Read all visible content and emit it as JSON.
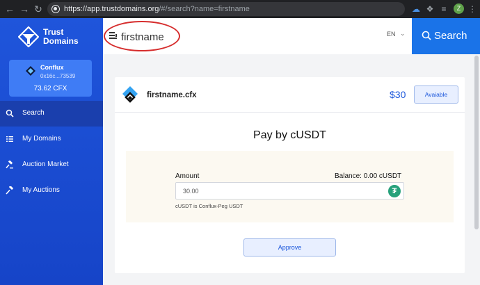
{
  "browser": {
    "url_host": "https://app.trustdomains.org",
    "url_rest": "/#/search?name=firstname",
    "profile_initial": "Z"
  },
  "brand": {
    "line1": "Trust",
    "line2": "Domains"
  },
  "wallet": {
    "name": "Conflux",
    "address": "0x16c...73539",
    "balance": "73.62 CFX"
  },
  "sidebar": {
    "items": [
      {
        "label": "Search",
        "icon": "search-icon",
        "active": true
      },
      {
        "label": "My Domains",
        "icon": "list-icon",
        "active": false
      },
      {
        "label": "Auction Market",
        "icon": "gavel-icon",
        "active": false
      },
      {
        "label": "My Auctions",
        "icon": "hammer-icon",
        "active": false
      }
    ]
  },
  "header": {
    "search_value": "firstname",
    "language": "EN",
    "search_button": "Search"
  },
  "domain": {
    "name": "firstname.cfx",
    "price": "$30",
    "status_button": "Avaiable"
  },
  "payment": {
    "title": "Pay by cUSDT",
    "amount_label": "Amount",
    "balance_label": "Balance: 0.00 cUSDT",
    "amount_value": "30.00",
    "hint": "cUSDT is Conflux-Peg USDT",
    "approve_button": "Approve"
  },
  "colors": {
    "sidebar": "#1f55db",
    "accent": "#1a73e8",
    "price": "#1a56db",
    "usdt": "#26a17b",
    "highlight": "#d62d2d"
  }
}
